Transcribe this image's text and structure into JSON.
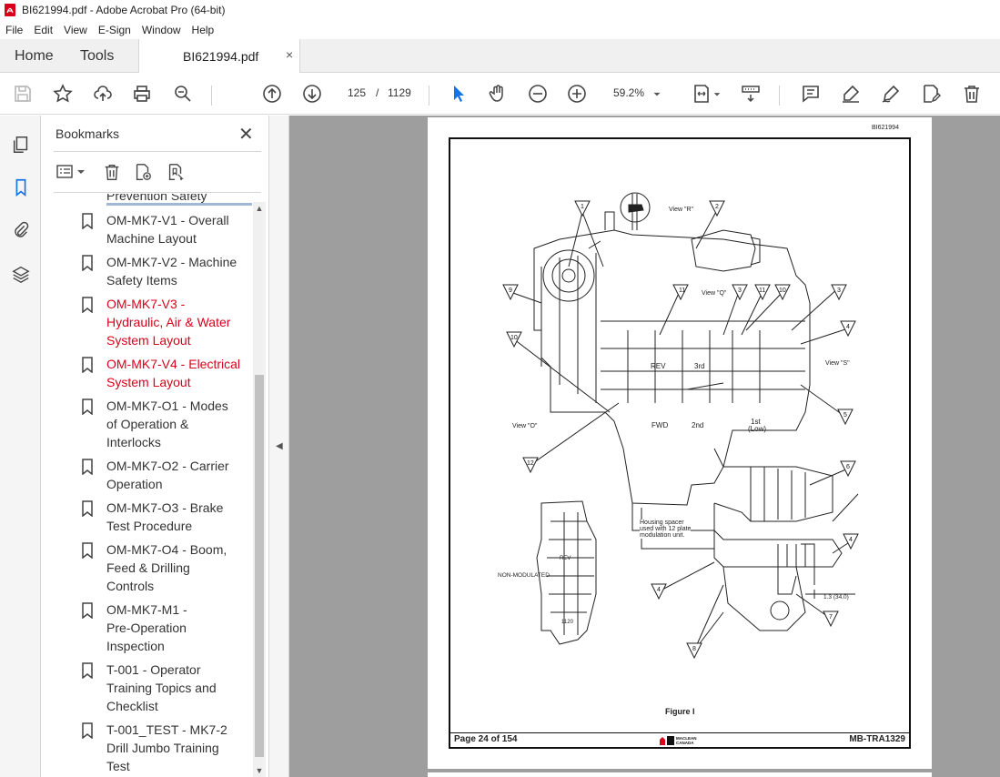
{
  "window": {
    "title": "BI621994.pdf - Adobe Acrobat Pro (64-bit)",
    "app_icon": "acrobat-icon",
    "accent": "#d9001b"
  },
  "menu": [
    "File",
    "Edit",
    "View",
    "E-Sign",
    "Window",
    "Help"
  ],
  "tabs": {
    "home": "Home",
    "tools": "Tools",
    "document": "BI621994.pdf",
    "close": "×"
  },
  "toolbar": {
    "current_page": "125",
    "page_separator": "/",
    "total_pages": "1129",
    "zoom": "59.2%",
    "icons": [
      "save-icon",
      "star-icon",
      "upload-icon",
      "print-icon",
      "zoom-search-icon",
      "page-up-icon",
      "page-down-icon",
      "select-arrow-icon",
      "hand-icon",
      "zoom-out-icon",
      "zoom-in-icon",
      "fit-page-icon",
      "scroll-mode-icon",
      "comment-icon",
      "highlight-icon",
      "sign-icon",
      "edit-pdf-icon",
      "delete-icon"
    ]
  },
  "bookmarks": {
    "title": "Bookmarks",
    "partial_item": "Prevention Safety",
    "items": [
      {
        "label": "OM-MK7-V1 - Overall Machine Layout",
        "lines": [
          "OM-MK7-V1 - Overall",
          "Machine Layout"
        ],
        "red": false
      },
      {
        "label": "OM-MK7-V2 - Machine Safety Items",
        "lines": [
          "OM-MK7-V2 - Machine",
          "Safety Items"
        ],
        "red": false
      },
      {
        "label": "OM-MK7-V3 - Hydraulic, Air & Water System Layout",
        "lines": [
          "OM-MK7-V3 -",
          "Hydraulic, Air & Water",
          "System Layout"
        ],
        "red": true
      },
      {
        "label": "OM-MK7-V4 - Electrical System Layout",
        "lines": [
          "OM-MK7-V4 - Electrical",
          "System Layout"
        ],
        "red": true
      },
      {
        "label": "OM-MK7-O1 - Modes of Operation & Interlocks",
        "lines": [
          "OM-MK7-O1 - Modes",
          "of Operation &",
          "Interlocks"
        ],
        "red": false
      },
      {
        "label": "OM-MK7-O2 - Carrier Operation",
        "lines": [
          "OM-MK7-O2 - Carrier",
          "Operation"
        ],
        "red": false
      },
      {
        "label": "OM-MK7-O3 - Brake Test Procedure",
        "lines": [
          "OM-MK7-O3 - Brake",
          "Test Procedure"
        ],
        "red": false
      },
      {
        "label": "OM-MK7-O4 - Boom, Feed & Drilling Controls",
        "lines": [
          "OM-MK7-O4 - Boom,",
          "Feed & Drilling",
          "Controls"
        ],
        "red": false
      },
      {
        "label": "OM-MK7-M1 - Pre-Operation Inspection",
        "lines": [
          "OM-MK7-M1 -",
          "Pre-Operation",
          "Inspection"
        ],
        "red": false
      },
      {
        "label": "T-001 - Operator Training Topics and Checklist",
        "lines": [
          "T-001 - Operator",
          "Training Topics and",
          "Checklist"
        ],
        "red": false
      },
      {
        "label": "T-001_TEST - MK7-2 Drill Jumbo Training Test",
        "lines": [
          "T-001_TEST - MK7-2",
          "Drill Jumbo Training",
          "Test"
        ],
        "red": false
      }
    ]
  },
  "document": {
    "doc_id": "BI621994",
    "figure_caption": "Figure I",
    "footer_left": "Page 24 of 154",
    "footer_right": "MB-TRA1329",
    "logo_text": "MACLEAN CANADA",
    "drawing_labels": {
      "view_r": "View \"R\"",
      "view_q": "View \"Q\"",
      "view_s": "View \"S\"",
      "view_o": "View \"O\"",
      "rev": "REV",
      "third": "3rd",
      "fwd": "FWD",
      "second": "2nd",
      "first": "1st",
      "low": "(Low)",
      "spacer1": "Housing spacer",
      "spacer2": "used with 12 plate",
      "spacer3": "modulation unit.",
      "non_modulated": "NON-MODULATED",
      "dimension": "1.3 (34.0)",
      "rev_small": "REV",
      "num_1120": "1120"
    },
    "callouts": [
      "1",
      "2",
      "3",
      "4",
      "5",
      "6",
      "7",
      "8",
      "9",
      "10",
      "11",
      "12"
    ]
  }
}
